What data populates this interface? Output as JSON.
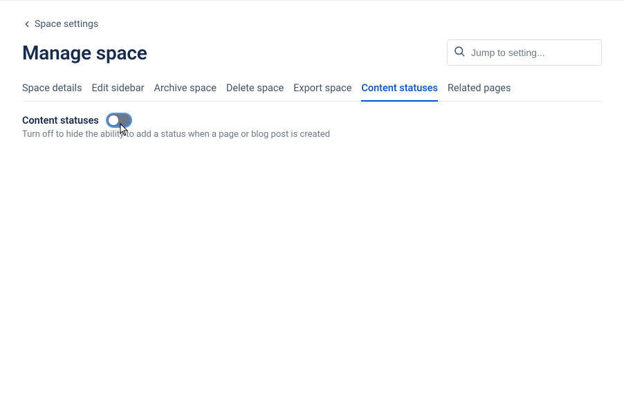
{
  "breadcrumb": {
    "label": "Space settings"
  },
  "header": {
    "title": "Manage space"
  },
  "search": {
    "placeholder": "Jump to setting..."
  },
  "tabs": [
    {
      "label": "Space details"
    },
    {
      "label": "Edit sidebar"
    },
    {
      "label": "Archive space"
    },
    {
      "label": "Delete space"
    },
    {
      "label": "Export space"
    },
    {
      "label": "Content statuses"
    },
    {
      "label": "Related pages"
    }
  ],
  "setting": {
    "label": "Content statuses",
    "description": "Turn off to hide the ability to add a status when a page or blog post is created",
    "enabled": false
  }
}
